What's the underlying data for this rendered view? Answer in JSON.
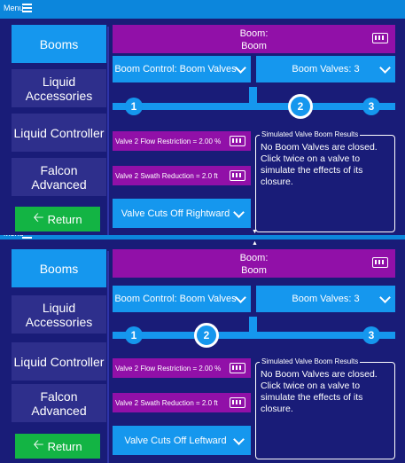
{
  "menu": {
    "label": "Menu"
  },
  "sidebar": {
    "items": [
      {
        "label": "Booms"
      },
      {
        "label": "Liquid Accessories"
      },
      {
        "label": "Liquid Controller"
      },
      {
        "label": "Falcon Advanced"
      }
    ],
    "return_label": "Return"
  },
  "boom": {
    "title_line1": "Boom:",
    "title_line2": "Boom"
  },
  "controls": {
    "boom_control": "Boom Control: Boom Valves",
    "boom_valves": "Boom Valves: 3"
  },
  "valve_nodes": [
    "1",
    "2",
    "3"
  ],
  "valve": {
    "flow_restriction": "Valve 2 Flow Restriction = 2.00 %",
    "swath_reduction": "Valve 2 Swath Reduction = 2.0 ft"
  },
  "results": {
    "legend": "Simulated Valve Boom Results",
    "line1": "No Boom Valves are closed.",
    "line2": "Click twice on a valve to simulate the effects of its closure."
  },
  "panels": [
    {
      "selected_node": 2,
      "cuts_off": "Valve Cuts Off Rightward"
    },
    {
      "selected_node": 2,
      "cuts_off": "Valve Cuts Off Leftward"
    }
  ],
  "colors": {
    "topbar": "#0c86dc",
    "accent_blue": "#1597ee",
    "boom_purple": "#9110a8",
    "return_green": "#13b444",
    "background": "#191c78"
  }
}
